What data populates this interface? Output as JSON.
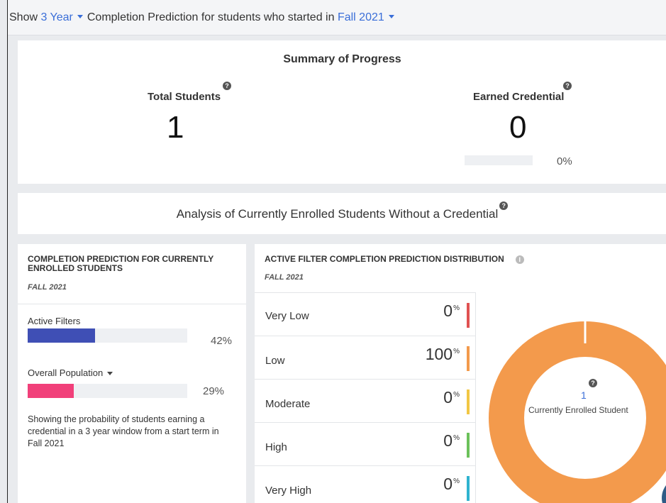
{
  "header": {
    "show_label": "Show",
    "year_option": "3 Year",
    "middle_text": "Completion Prediction for students who started in",
    "term_option": "Fall 2021"
  },
  "summary": {
    "title": "Summary of Progress",
    "total_students": {
      "label": "Total Students",
      "value": "1"
    },
    "earned_credential": {
      "label": "Earned Credential",
      "value": "0",
      "percent": "0%",
      "fraction": 0
    }
  },
  "analysis": {
    "title": "Analysis of Currently Enrolled Students Without a Credential"
  },
  "completion_prediction": {
    "title": "Completion Prediction for Currently Enrolled Students",
    "subtitle": "FALL 2021",
    "active_filters": {
      "label": "Active Filters",
      "percent": "42%",
      "fraction": 0.42,
      "color": "#3f4fb5"
    },
    "overall_population": {
      "label": "Overall Population",
      "percent": "29%",
      "fraction": 0.29,
      "color": "#f1407a"
    },
    "description": "Showing the probability of students earning a credential in a 3 year window from a start term in Fall 2021"
  },
  "distribution": {
    "title": "Active Filter Completion Prediction Distribution",
    "subtitle": "FALL 2021",
    "rows": [
      {
        "label": "Very Low",
        "value": "0",
        "unit": "%",
        "color": "#e05252"
      },
      {
        "label": "Low",
        "value": "100",
        "unit": "%",
        "color": "#f39a4c"
      },
      {
        "label": "Moderate",
        "value": "0",
        "unit": "%",
        "color": "#f2c744"
      },
      {
        "label": "High",
        "value": "0",
        "unit": "%",
        "color": "#6cc15a"
      },
      {
        "label": "Very High",
        "value": "0",
        "unit": "%",
        "color": "#2fb3cf"
      }
    ],
    "donut": {
      "count": "1",
      "label": "Currently Enrolled Student",
      "color": "#f39a4c"
    }
  }
}
